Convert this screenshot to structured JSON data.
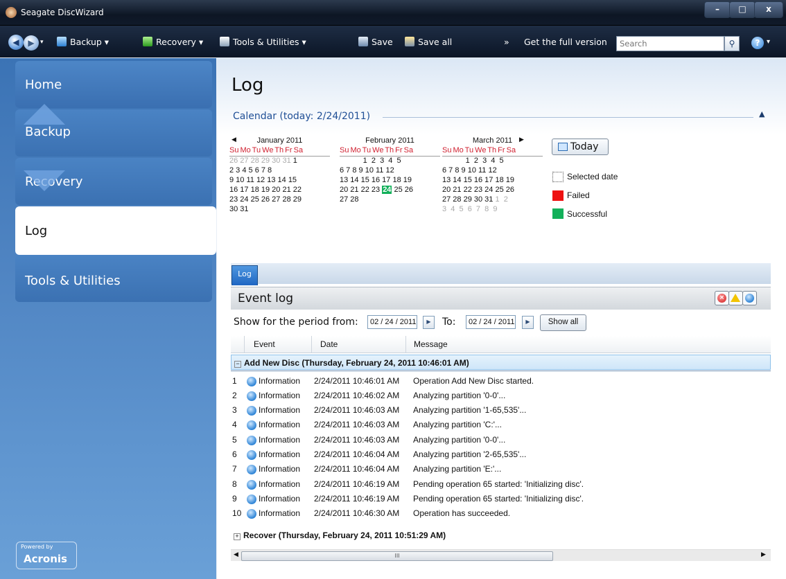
{
  "window": {
    "title": "Seagate DiscWizard",
    "min": "–",
    "max": "□",
    "close": "x"
  },
  "toolbar": {
    "backup": "Backup ▾",
    "recovery": "Recovery ▾",
    "tools": "Tools & Utilities ▾",
    "save": "Save",
    "save_all": "Save all",
    "more": "»",
    "full_version": "Get the full version",
    "search_placeholder": "Search"
  },
  "sidebar": {
    "home": "Home",
    "backup": "Backup",
    "recovery": "Recovery",
    "log": "Log",
    "tools": "Tools & Utilities",
    "powered_by": "Powered by",
    "brand": "Acronis"
  },
  "page": {
    "title": "Log",
    "calendar_section": "Calendar (today: 2/24/2011)"
  },
  "calendar": {
    "day_headers": "Su Mo Tu We Th Fr Sa",
    "months": [
      {
        "name": "January 2011",
        "rows": [
          [
            "26 27 28 29 30 31",
            " 1"
          ],
          [
            "",
            "2  3  4  5  6  7  8"
          ],
          [
            "",
            "9 10 11 12 13 14 15"
          ],
          [
            "",
            "16 17 18 19 20 21 22"
          ],
          [
            "",
            "23 24 25 26 27 28 29"
          ],
          [
            "",
            "30 31"
          ]
        ]
      },
      {
        "name": "February 2011",
        "rows": [
          [
            "",
            "           1  2  3  4  5"
          ],
          [
            "",
            "6  7  8  9 10 11 12"
          ],
          [
            "",
            "13 14 15 16 17 18 19"
          ],
          [
            "",
            "20 21 22 23"
          ],
          [
            "",
            "27 28"
          ]
        ]
      },
      {
        "name": "March 2011",
        "rows": [
          [
            "",
            "           1  2  3  4  5"
          ],
          [
            "",
            "6  7  8  9 10 11 12"
          ],
          [
            "",
            "13 14 15 16 17 18 19"
          ],
          [
            "",
            "20 21 22 23 24 25 26"
          ],
          [
            "",
            "27 28 29 30 31"
          ],
          [
            "3  4  5  6  7  8  9",
            ""
          ]
        ]
      }
    ],
    "feb_today": "24",
    "feb_after_today": " 25 26",
    "mar_next_month": " 1  2",
    "today_button": "Today",
    "legend": [
      {
        "label": "Selected date",
        "color": "#ffffff"
      },
      {
        "label": "Failed",
        "color": "#ee1111"
      },
      {
        "label": "Successful",
        "color": "#13b05a"
      }
    ]
  },
  "log": {
    "tab": "Log",
    "event_log_title": "Event log",
    "period_label": "Show for the period from:",
    "date_from": "02 / 24 / 2011",
    "to_label": "To:",
    "date_to": "02 / 24 / 2011",
    "show_all": "Show all",
    "columns": [
      "Event",
      "Date",
      "Message"
    ],
    "groups": [
      {
        "title": "Add New Disc  (Thursday, February 24, 2011 10:46:01 AM)",
        "expanded": true,
        "rows": [
          {
            "n": "1",
            "event": "Information",
            "date": "2/24/2011 10:46:01 AM",
            "message": "Operation Add New Disc started."
          },
          {
            "n": "2",
            "event": "Information",
            "date": "2/24/2011 10:46:02 AM",
            "message": "Analyzing partition '0-0'..."
          },
          {
            "n": "3",
            "event": "Information",
            "date": "2/24/2011 10:46:03 AM",
            "message": "Analyzing partition '1-65,535'..."
          },
          {
            "n": "4",
            "event": "Information",
            "date": "2/24/2011 10:46:03 AM",
            "message": "Analyzing partition 'C:'..."
          },
          {
            "n": "5",
            "event": "Information",
            "date": "2/24/2011 10:46:03 AM",
            "message": "Analyzing partition '0-0'..."
          },
          {
            "n": "6",
            "event": "Information",
            "date": "2/24/2011 10:46:04 AM",
            "message": "Analyzing partition '2-65,535'..."
          },
          {
            "n": "7",
            "event": "Information",
            "date": "2/24/2011 10:46:04 AM",
            "message": "Analyzing partition 'E:'..."
          },
          {
            "n": "8",
            "event": "Information",
            "date": "2/24/2011 10:46:19 AM",
            "message": "Pending operation 65 started: 'Initializing disc'."
          },
          {
            "n": "9",
            "event": "Information",
            "date": "2/24/2011 10:46:19 AM",
            "message": "Pending operation 65 started: 'Initializing disc'."
          },
          {
            "n": "10",
            "event": "Information",
            "date": "2/24/2011 10:46:30 AM",
            "message": "Operation has succeeded."
          }
        ]
      },
      {
        "title": "Recover  (Thursday, February 24, 2011 10:51:29 AM)",
        "expanded": false,
        "rows": []
      }
    ],
    "scroll_grip": "III"
  },
  "icons": [
    "back-icon",
    "forward-icon",
    "backup-icon",
    "recovery-icon",
    "tools-icon",
    "save-icon",
    "save-all-icon",
    "search-icon",
    "help-icon",
    "info-icon",
    "error-filter-icon",
    "warning-filter-icon",
    "info-filter-icon"
  ]
}
